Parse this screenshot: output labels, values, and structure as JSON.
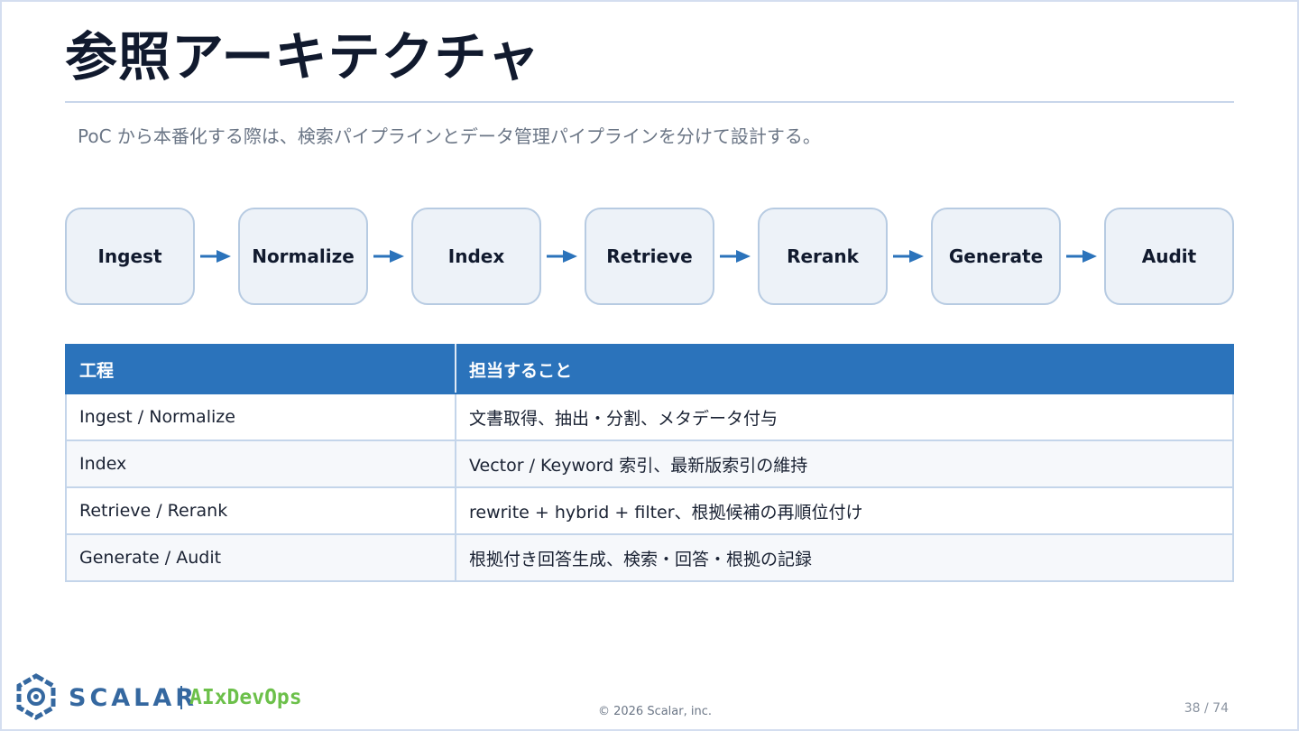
{
  "slide": {
    "title": "参照アーキテクチャ",
    "subtitle": "PoC から本番化する際は、検索パイプラインとデータ管理パイプラインを分けて設計する。"
  },
  "pipeline": {
    "steps": [
      "Ingest",
      "Normalize",
      "Index",
      "Retrieve",
      "Rerank",
      "Generate",
      "Audit"
    ],
    "arrow_color": "#2b73bb"
  },
  "table": {
    "headers": [
      "工程",
      "担当すること"
    ],
    "rows": [
      [
        "Ingest / Normalize",
        "文書取得、抽出・分割、メタデータ付与"
      ],
      [
        "Index",
        "Vector / Keyword 索引、最新版索引の維持"
      ],
      [
        "Retrieve / Rerank",
        "rewrite + hybrid + filter、根拠候補の再順位付け"
      ],
      [
        "Generate / Audit",
        "根拠付き回答生成、検索・回答・根拠の記録"
      ]
    ],
    "header_color": "#2b73bb"
  },
  "footer": {
    "brand": "SCALAR",
    "brand_sub": "AIxDevOps",
    "copyright": "© 2026 Scalar, inc.",
    "page": "38 / 74"
  }
}
